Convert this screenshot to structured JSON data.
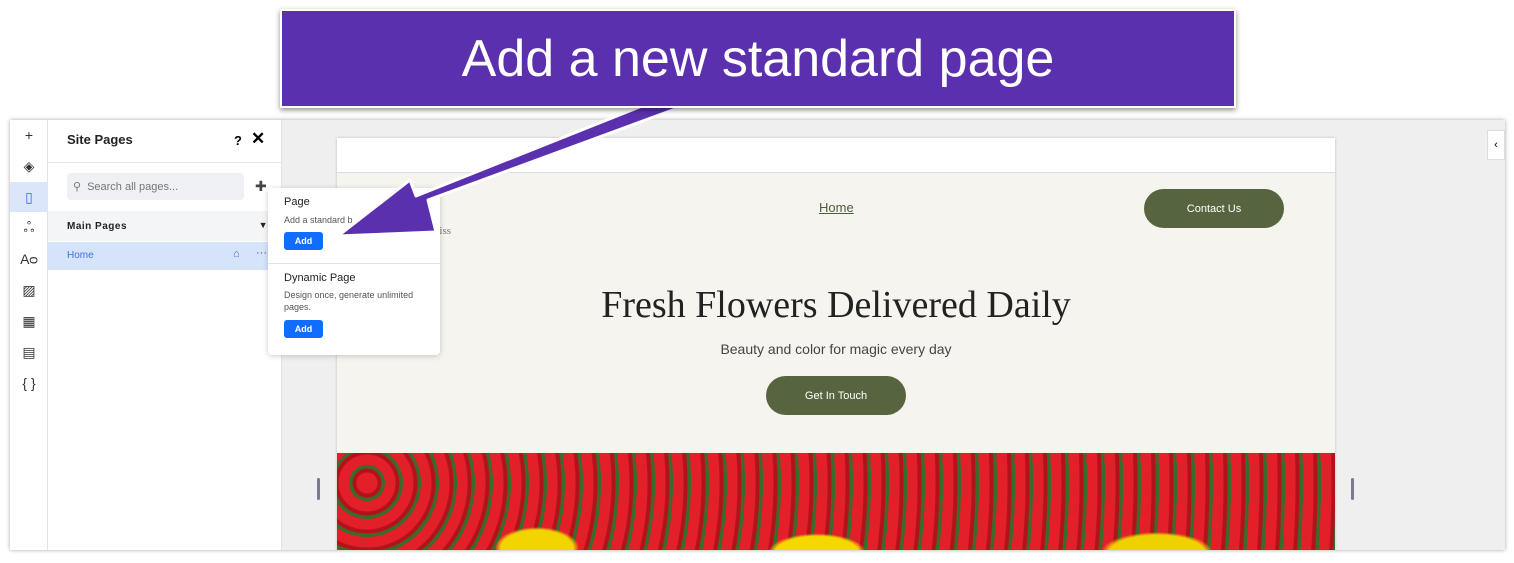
{
  "banner": {
    "text": "Add a new standard page",
    "color": "#5b30ae"
  },
  "toolbar": {
    "items": [
      "add-icon",
      "layers-icon",
      "pages-icon",
      "apps-icon",
      "text-theme-icon",
      "media-icon",
      "blocks-icon",
      "table-icon",
      "code-icon"
    ],
    "glyphs": [
      "+",
      "◈",
      "▯",
      "ஃ",
      "Aᴑ",
      "▨",
      "▦",
      "▤",
      "{ }"
    ],
    "active": "pages-icon"
  },
  "panel": {
    "title": "Site Pages",
    "help": "?",
    "close": "✕",
    "search_placeholder": "Search all pages...",
    "section": "Main Pages",
    "pages": [
      {
        "label": "Home"
      }
    ]
  },
  "popup": {
    "page_title": "Page",
    "page_desc": "Add a standard b",
    "add": "Add",
    "dynamic_title": "Dynamic Page",
    "dynamic_desc": "Design once, generate unlimited pages.",
    "dynamic_add": "Add"
  },
  "site": {
    "nav_home": "Home",
    "contact": "Contact Us",
    "logo_partial": "Bliss",
    "headline": "Fresh Flowers Delivered Daily",
    "subtitle": "Beauty and color for magic every day",
    "cta": "Get In Touch",
    "button_color": "#56653f"
  },
  "accent": "#116dff"
}
